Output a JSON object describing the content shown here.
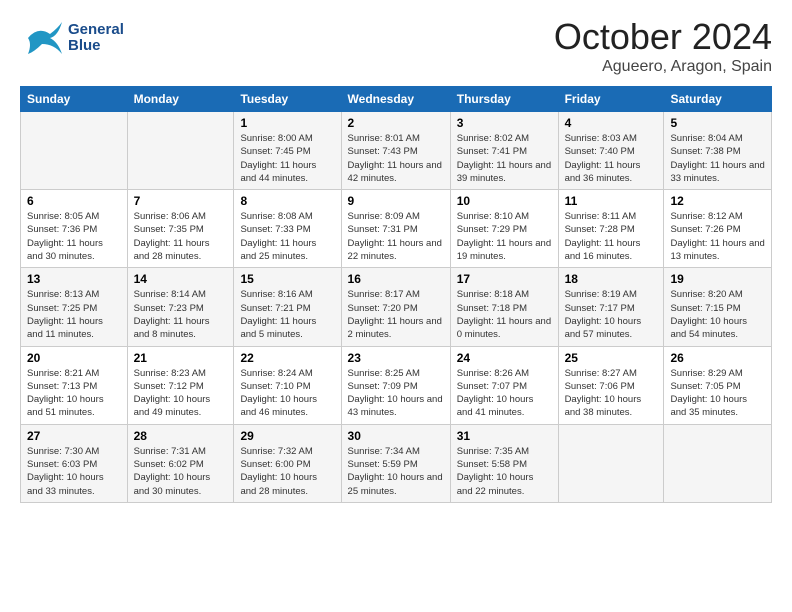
{
  "header": {
    "logo_line1": "General",
    "logo_line2": "Blue",
    "month": "October 2024",
    "location": "Agueero, Aragon, Spain"
  },
  "weekdays": [
    "Sunday",
    "Monday",
    "Tuesday",
    "Wednesday",
    "Thursday",
    "Friday",
    "Saturday"
  ],
  "weeks": [
    [
      {
        "day": "",
        "info": ""
      },
      {
        "day": "",
        "info": ""
      },
      {
        "day": "1",
        "info": "Sunrise: 8:00 AM\nSunset: 7:45 PM\nDaylight: 11 hours and 44 minutes."
      },
      {
        "day": "2",
        "info": "Sunrise: 8:01 AM\nSunset: 7:43 PM\nDaylight: 11 hours and 42 minutes."
      },
      {
        "day": "3",
        "info": "Sunrise: 8:02 AM\nSunset: 7:41 PM\nDaylight: 11 hours and 39 minutes."
      },
      {
        "day": "4",
        "info": "Sunrise: 8:03 AM\nSunset: 7:40 PM\nDaylight: 11 hours and 36 minutes."
      },
      {
        "day": "5",
        "info": "Sunrise: 8:04 AM\nSunset: 7:38 PM\nDaylight: 11 hours and 33 minutes."
      }
    ],
    [
      {
        "day": "6",
        "info": "Sunrise: 8:05 AM\nSunset: 7:36 PM\nDaylight: 11 hours and 30 minutes."
      },
      {
        "day": "7",
        "info": "Sunrise: 8:06 AM\nSunset: 7:35 PM\nDaylight: 11 hours and 28 minutes."
      },
      {
        "day": "8",
        "info": "Sunrise: 8:08 AM\nSunset: 7:33 PM\nDaylight: 11 hours and 25 minutes."
      },
      {
        "day": "9",
        "info": "Sunrise: 8:09 AM\nSunset: 7:31 PM\nDaylight: 11 hours and 22 minutes."
      },
      {
        "day": "10",
        "info": "Sunrise: 8:10 AM\nSunset: 7:29 PM\nDaylight: 11 hours and 19 minutes."
      },
      {
        "day": "11",
        "info": "Sunrise: 8:11 AM\nSunset: 7:28 PM\nDaylight: 11 hours and 16 minutes."
      },
      {
        "day": "12",
        "info": "Sunrise: 8:12 AM\nSunset: 7:26 PM\nDaylight: 11 hours and 13 minutes."
      }
    ],
    [
      {
        "day": "13",
        "info": "Sunrise: 8:13 AM\nSunset: 7:25 PM\nDaylight: 11 hours and 11 minutes."
      },
      {
        "day": "14",
        "info": "Sunrise: 8:14 AM\nSunset: 7:23 PM\nDaylight: 11 hours and 8 minutes."
      },
      {
        "day": "15",
        "info": "Sunrise: 8:16 AM\nSunset: 7:21 PM\nDaylight: 11 hours and 5 minutes."
      },
      {
        "day": "16",
        "info": "Sunrise: 8:17 AM\nSunset: 7:20 PM\nDaylight: 11 hours and 2 minutes."
      },
      {
        "day": "17",
        "info": "Sunrise: 8:18 AM\nSunset: 7:18 PM\nDaylight: 11 hours and 0 minutes."
      },
      {
        "day": "18",
        "info": "Sunrise: 8:19 AM\nSunset: 7:17 PM\nDaylight: 10 hours and 57 minutes."
      },
      {
        "day": "19",
        "info": "Sunrise: 8:20 AM\nSunset: 7:15 PM\nDaylight: 10 hours and 54 minutes."
      }
    ],
    [
      {
        "day": "20",
        "info": "Sunrise: 8:21 AM\nSunset: 7:13 PM\nDaylight: 10 hours and 51 minutes."
      },
      {
        "day": "21",
        "info": "Sunrise: 8:23 AM\nSunset: 7:12 PM\nDaylight: 10 hours and 49 minutes."
      },
      {
        "day": "22",
        "info": "Sunrise: 8:24 AM\nSunset: 7:10 PM\nDaylight: 10 hours and 46 minutes."
      },
      {
        "day": "23",
        "info": "Sunrise: 8:25 AM\nSunset: 7:09 PM\nDaylight: 10 hours and 43 minutes."
      },
      {
        "day": "24",
        "info": "Sunrise: 8:26 AM\nSunset: 7:07 PM\nDaylight: 10 hours and 41 minutes."
      },
      {
        "day": "25",
        "info": "Sunrise: 8:27 AM\nSunset: 7:06 PM\nDaylight: 10 hours and 38 minutes."
      },
      {
        "day": "26",
        "info": "Sunrise: 8:29 AM\nSunset: 7:05 PM\nDaylight: 10 hours and 35 minutes."
      }
    ],
    [
      {
        "day": "27",
        "info": "Sunrise: 7:30 AM\nSunset: 6:03 PM\nDaylight: 10 hours and 33 minutes."
      },
      {
        "day": "28",
        "info": "Sunrise: 7:31 AM\nSunset: 6:02 PM\nDaylight: 10 hours and 30 minutes."
      },
      {
        "day": "29",
        "info": "Sunrise: 7:32 AM\nSunset: 6:00 PM\nDaylight: 10 hours and 28 minutes."
      },
      {
        "day": "30",
        "info": "Sunrise: 7:34 AM\nSunset: 5:59 PM\nDaylight: 10 hours and 25 minutes."
      },
      {
        "day": "31",
        "info": "Sunrise: 7:35 AM\nSunset: 5:58 PM\nDaylight: 10 hours and 22 minutes."
      },
      {
        "day": "",
        "info": ""
      },
      {
        "day": "",
        "info": ""
      }
    ]
  ]
}
